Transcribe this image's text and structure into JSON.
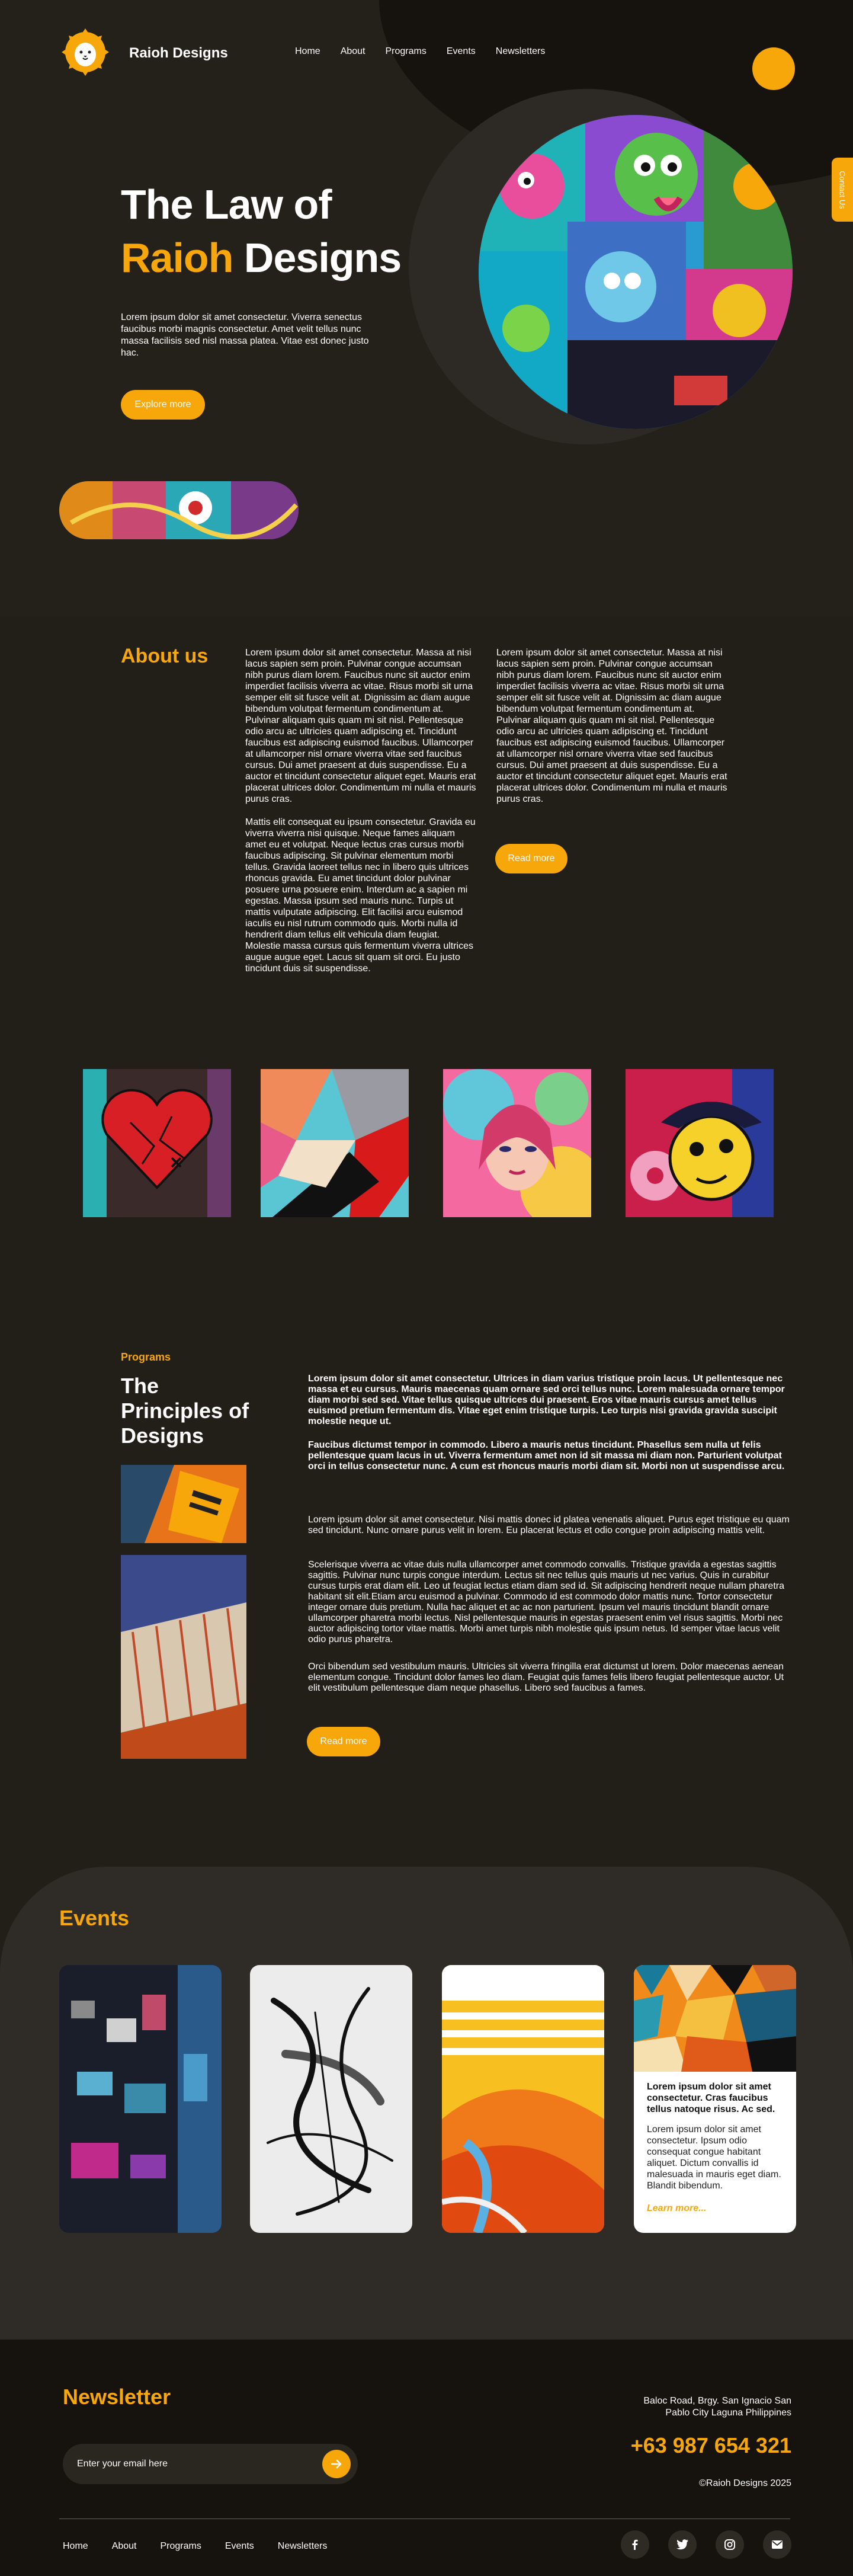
{
  "header": {
    "brand": "Raioh Designs",
    "nav": [
      "Home",
      "About",
      "Programs",
      "Events",
      "Newsletters"
    ],
    "contact_tab": "Contact Us"
  },
  "hero": {
    "title_line1": "The Law of",
    "title_accent": "Raioh",
    "title_rest": "Designs",
    "text": "Lorem ipsum dolor sit amet consectetur. Viverra senectus faucibus morbi magnis consectetur. Amet velit tellus nunc massa facilisis sed nisl massa platea. Vitae est donec justo hac.",
    "button": "Explore more"
  },
  "about": {
    "heading": "About us",
    "col1_p1": "Lorem ipsum dolor sit amet consectetur. Massa at nisi lacus sapien sem proin. Pulvinar congue accumsan nibh purus diam lorem. Faucibus nunc sit auctor enim imperdiet facilisis viverra ac vitae. Risus morbi sit urna semper elit sit fusce velit at. Dignissim ac diam augue bibendum volutpat fermentum condimentum at. Pulvinar aliquam quis quam mi sit nisl. Pellentesque odio arcu ac ultricies quam adipiscing et. Tincidunt faucibus est adipiscing euismod faucibus. Ullamcorper at ullamcorper nisl ornare viverra vitae sed faucibus cursus. Dui amet praesent at duis suspendisse. Eu a auctor et tincidunt consectetur aliquet eget. Mauris erat placerat ultrices dolor. Condimentum mi nulla et mauris purus cras.",
    "col1_p2": "Mattis elit consequat eu ipsum consectetur. Gravida eu viverra viverra nisi quisque. Neque fames aliquam amet eu et volutpat. Neque lectus cras cursus morbi faucibus adipiscing. Sit pulvinar elementum morbi tellus. Gravida laoreet tellus nec in libero quis ultrices rhoncus gravida. Eu amet tincidunt dolor pulvinar posuere urna posuere enim. Interdum ac a sapien mi egestas. Massa ipsum sed mauris nunc. Turpis ut mattis vulputate adipiscing. Elit facilisi arcu euismod iaculis eu nisl rutrum commodo quis. Morbi nulla id hendrerit diam tellus elit vehicula diam feugiat. Molestie massa cursus quis fermentum viverra ultrices augue augue eget. Lacus sit quam sit orci. Eu justo tincidunt duis sit suspendisse.",
    "col2_p1": "Lorem ipsum dolor sit amet consectetur. Massa at nisi lacus sapien sem proin. Pulvinar congue accumsan nibh purus diam lorem. Faucibus nunc sit auctor enim imperdiet facilisis viverra ac vitae. Risus morbi sit urna semper elit sit fusce velit at. Dignissim ac diam augue bibendum volutpat fermentum condimentum at. Pulvinar aliquam quis quam mi sit nisl. Pellentesque odio arcu ac ultricies quam adipiscing et. Tincidunt faucibus est adipiscing euismod faucibus. Ullamcorper at ullamcorper nisl ornare viverra vitae sed faucibus cursus. Dui amet praesent at duis suspendisse. Eu a auctor et tincidunt consectetur aliquet eget. Mauris erat placerat ultrices dolor. Condimentum mi nulla et mauris purus cras.",
    "button": "Read more"
  },
  "programs": {
    "tag": "Programs",
    "heading": "The Principles of Designs",
    "bold1": "Lorem ipsum dolor sit amet consectetur. Ultrices in diam varius tristique proin lacus. Ut pellentesque nec massa et eu cursus. Mauris maecenas quam ornare sed orci tellus nunc. Lorem malesuada ornare tempor diam morbi sed sed. Vitae tellus quisque ultrices dui praesent. Eros vitae mauris cursus amet tellus euismod pretium fermentum dis. Vitae eget enim tristique turpis. Leo turpis nisi gravida gravida suscipit molestie neque ut.",
    "bold2": "Faucibus dictumst tempor in commodo. Libero a mauris netus tincidunt. Phasellus sem nulla ut felis pellentesque quam lacus in ut. Viverra fermentum amet non id sit massa mi diam non. Parturient volutpat orci in tellus consectetur nunc. A cum est rhoncus mauris morbi diam sit. Morbi non ut suspendisse arcu.",
    "p3": "Lorem ipsum dolor sit amet consectetur. Nisi mattis donec id platea venenatis aliquet. Purus eget tristique eu quam sed tincidunt. Nunc ornare purus velit in lorem. Eu placerat lectus et odio congue proin adipiscing mattis velit.",
    "p4": "Scelerisque viverra ac vitae duis nulla ullamcorper amet commodo convallis. Tristique gravida a egestas sagittis sagittis. Pulvinar nunc turpis congue interdum. Lectus sit nec tellus quis mauris ut nec varius. Quis in curabitur cursus turpis erat diam elit. Leo ut feugiat lectus etiam diam sed id. Sit adipiscing hendrerit neque nullam pharetra habitant sit elit.Etiam arcu euismod a pulvinar. Commodo id est commodo dolor mattis nunc. Tortor consectetur integer ornare duis pretium. Nulla hac aliquet et ac ac non parturient. Ipsum vel mauris tincidunt blandit ornare ullamcorper pharetra morbi lectus. Nisl pellentesque mauris in egestas praesent enim vel risus sagittis. Morbi nec auctor adipiscing tortor vitae mattis. Morbi amet turpis nibh molestie quis ipsum netus. Id semper vitae lacus velit odio purus pharetra.",
    "p5": "Orci bibendum sed vestibulum mauris. Ultricies sit viverra fringilla erat dictumst ut lorem. Dolor maecenas aenean elementum congue. Tincidunt dolor fames leo diam. Feugiat quis fames felis libero feugiat pellentesque auctor. Ut elit vestibulum pellentesque diam neque phasellus. Libero sed faucibus a fames.",
    "button": "Read more"
  },
  "events": {
    "heading": "Events",
    "card_title": "Lorem ipsum dolor sit amet consectetur. Cras faucibus tellus natoque risus. Ac sed.",
    "card_text": "Lorem ipsum dolor sit amet consectetur. Ipsum odio consequat congue habitant aliquet. Dictum convallis id malesuada in mauris eget diam. Blandit bibendum.",
    "card_link": "Learn more..."
  },
  "newsletter": {
    "heading": "Newsletter",
    "placeholder": "Enter your email here"
  },
  "footer": {
    "address_line1": "Baloc Road, Brgy. San Ignacio San",
    "address_line2": "Pablo City Laguna Philippines",
    "phone": "+63 987 654 321",
    "copyright": "©Raioh Designs 2025",
    "nav": [
      "Home",
      "About",
      "Programs",
      "Events",
      "Newsletters"
    ]
  },
  "colors": {
    "accent": "#f7a70a",
    "background": "#221e18",
    "footer_bg": "#16130f"
  },
  "icons": [
    "lion-logo-icon",
    "arrow-right-icon",
    "facebook-icon",
    "twitter-icon",
    "instagram-icon",
    "mail-icon"
  ]
}
